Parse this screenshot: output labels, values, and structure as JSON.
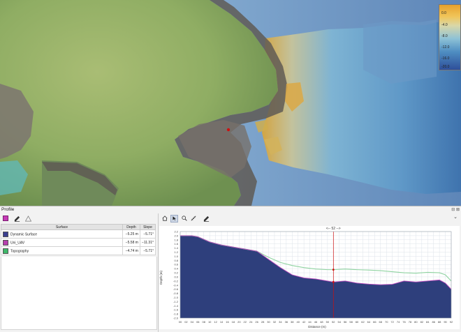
{
  "map": {
    "legend": {
      "ticks": [
        "0.0",
        "-4.0",
        "-8.0",
        "-12.0",
        "-16.0",
        "-20.0"
      ],
      "colors": [
        "#e8a12b",
        "#f0c55a",
        "#d9d7a8",
        "#8ec2d6",
        "#4f8ec2",
        "#2e4f9a"
      ]
    },
    "marker_color": "#cc1111"
  },
  "panel": {
    "title": "Profile",
    "window_icons": "⊟ ⊠",
    "collapse_icon": "⌄",
    "left_tools": [
      "add-surface-swatch",
      "pen-icon",
      "warning-icon"
    ],
    "table": {
      "headers": {
        "surface": "Surface",
        "depth": "Depth",
        "slope": "Slope"
      },
      "rows": [
        {
          "name": "Dynamic Surface",
          "depth": "−5.25 m",
          "slope": "−5.71°",
          "color": "#3a3f8f"
        },
        {
          "name": "Uni_UAV",
          "depth": "−5.58 m",
          "slope": "−11.31°",
          "color": "#b63fae"
        },
        {
          "name": "Topography",
          "depth": "−4.74 m",
          "slope": "−5.71°",
          "color": "#3fb86a"
        }
      ]
    },
    "right_tools": [
      "home-icon",
      "pointer-icon",
      "zoom-icon",
      "measure-icon",
      "pen-icon"
    ]
  },
  "chart_data": {
    "type": "area",
    "title": "",
    "xlabel": "Distance (m)",
    "ylabel": "Depth (m)",
    "cursor_label": "<-- 52 -->",
    "cursor_x": 52,
    "xlim": [
      0,
      92
    ],
    "ylim": [
      -2.0,
      2.2
    ],
    "x": [
      0,
      4,
      6,
      10,
      14,
      18,
      22,
      26,
      30,
      34,
      38,
      42,
      46,
      50,
      52,
      56,
      60,
      64,
      68,
      72,
      76,
      80,
      84,
      88,
      90,
      92
    ],
    "series": [
      {
        "name": "Topography",
        "values": [
          2.0,
          2.0,
          1.95,
          1.7,
          1.55,
          1.45,
          1.35,
          1.25,
          0.95,
          0.7,
          0.55,
          0.45,
          0.38,
          0.35,
          0.35,
          0.38,
          0.35,
          0.33,
          0.3,
          0.25,
          0.2,
          0.18,
          0.22,
          0.2,
          0.1,
          -0.2
        ]
      },
      {
        "name": "Uni_UAV",
        "values": [
          2.0,
          2.0,
          1.95,
          1.7,
          1.55,
          1.45,
          1.35,
          1.25,
          0.85,
          0.45,
          0.1,
          -0.05,
          -0.1,
          -0.2,
          -0.25,
          -0.2,
          -0.3,
          -0.35,
          -0.38,
          -0.36,
          -0.2,
          -0.25,
          -0.2,
          -0.15,
          -0.3,
          -0.6
        ]
      },
      {
        "name": "Dynamic Surface",
        "values": [
          2.0,
          2.0,
          1.95,
          1.7,
          1.55,
          1.45,
          1.35,
          1.25,
          0.85,
          0.45,
          0.1,
          -0.05,
          -0.1,
          -0.2,
          -0.25,
          -0.2,
          -0.3,
          -0.35,
          -0.38,
          -0.36,
          -0.2,
          -0.25,
          -0.2,
          -0.15,
          -0.3,
          -0.6
        ]
      }
    ],
    "y_ticks": [
      "2.2",
      "2.0",
      "1.8",
      "1.6",
      "1.4",
      "1.2",
      "1.0",
      "0.8",
      "0.6",
      "0.4",
      "0.2",
      "0.0",
      "-0.2",
      "-0.4",
      "-0.6",
      "-0.8",
      "-1.0",
      "-1.2",
      "-1.4",
      "-1.6",
      "-1.8",
      "-2.0"
    ],
    "x_ticks": [
      "00",
      "02",
      "04",
      "06",
      "08",
      "10",
      "12",
      "14",
      "16",
      "18",
      "20",
      "22",
      "24",
      "26",
      "28",
      "30",
      "32",
      "34",
      "36",
      "38",
      "40",
      "42",
      "44",
      "46",
      "48",
      "50",
      "52",
      "54",
      "56",
      "58",
      "60",
      "62",
      "64",
      "66",
      "68",
      "70",
      "72",
      "74",
      "76",
      "78",
      "80",
      "82",
      "84",
      "86",
      "88",
      "90",
      "92"
    ],
    "grid": true,
    "colors": {
      "fill": "#2e3f7c",
      "topography": "#8fd3a0",
      "uni_uav": "#c04dc0",
      "cursor": "#cc1111"
    }
  }
}
